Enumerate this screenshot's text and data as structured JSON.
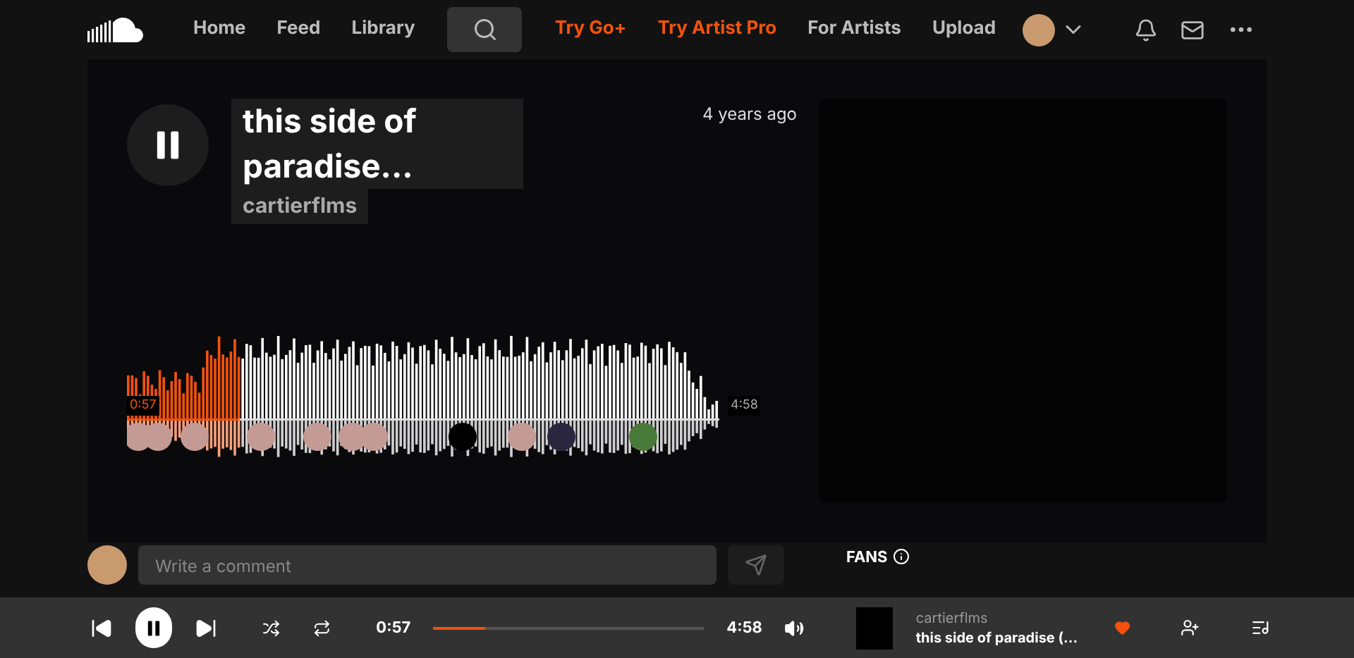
{
  "nav": {
    "items": [
      {
        "label": "Home",
        "kind": "link"
      },
      {
        "label": "Feed",
        "kind": "link"
      },
      {
        "label": "Library",
        "kind": "link"
      },
      {
        "kind": "search"
      },
      {
        "label": "Try Go+",
        "kind": "promo"
      },
      {
        "label": "Try Artist Pro",
        "kind": "promo"
      },
      {
        "label": "For Artists",
        "kind": "link"
      },
      {
        "label": "Upload",
        "kind": "link"
      }
    ]
  },
  "hero": {
    "playing": true,
    "title": "this side of paradise...",
    "artist": "cartierflms",
    "age": "4 years ago",
    "current": "0:57",
    "duration": "4:58",
    "level": 0.19
  },
  "comment": {
    "placeholder": "Write a comment"
  },
  "fans": {
    "title": "FANS"
  },
  "player": {
    "playing": true,
    "current": "0:57",
    "duration": "4:58",
    "level": 0.19,
    "artist": "cartierflms",
    "title": "this side of paradise (...",
    "liked": true
  }
}
